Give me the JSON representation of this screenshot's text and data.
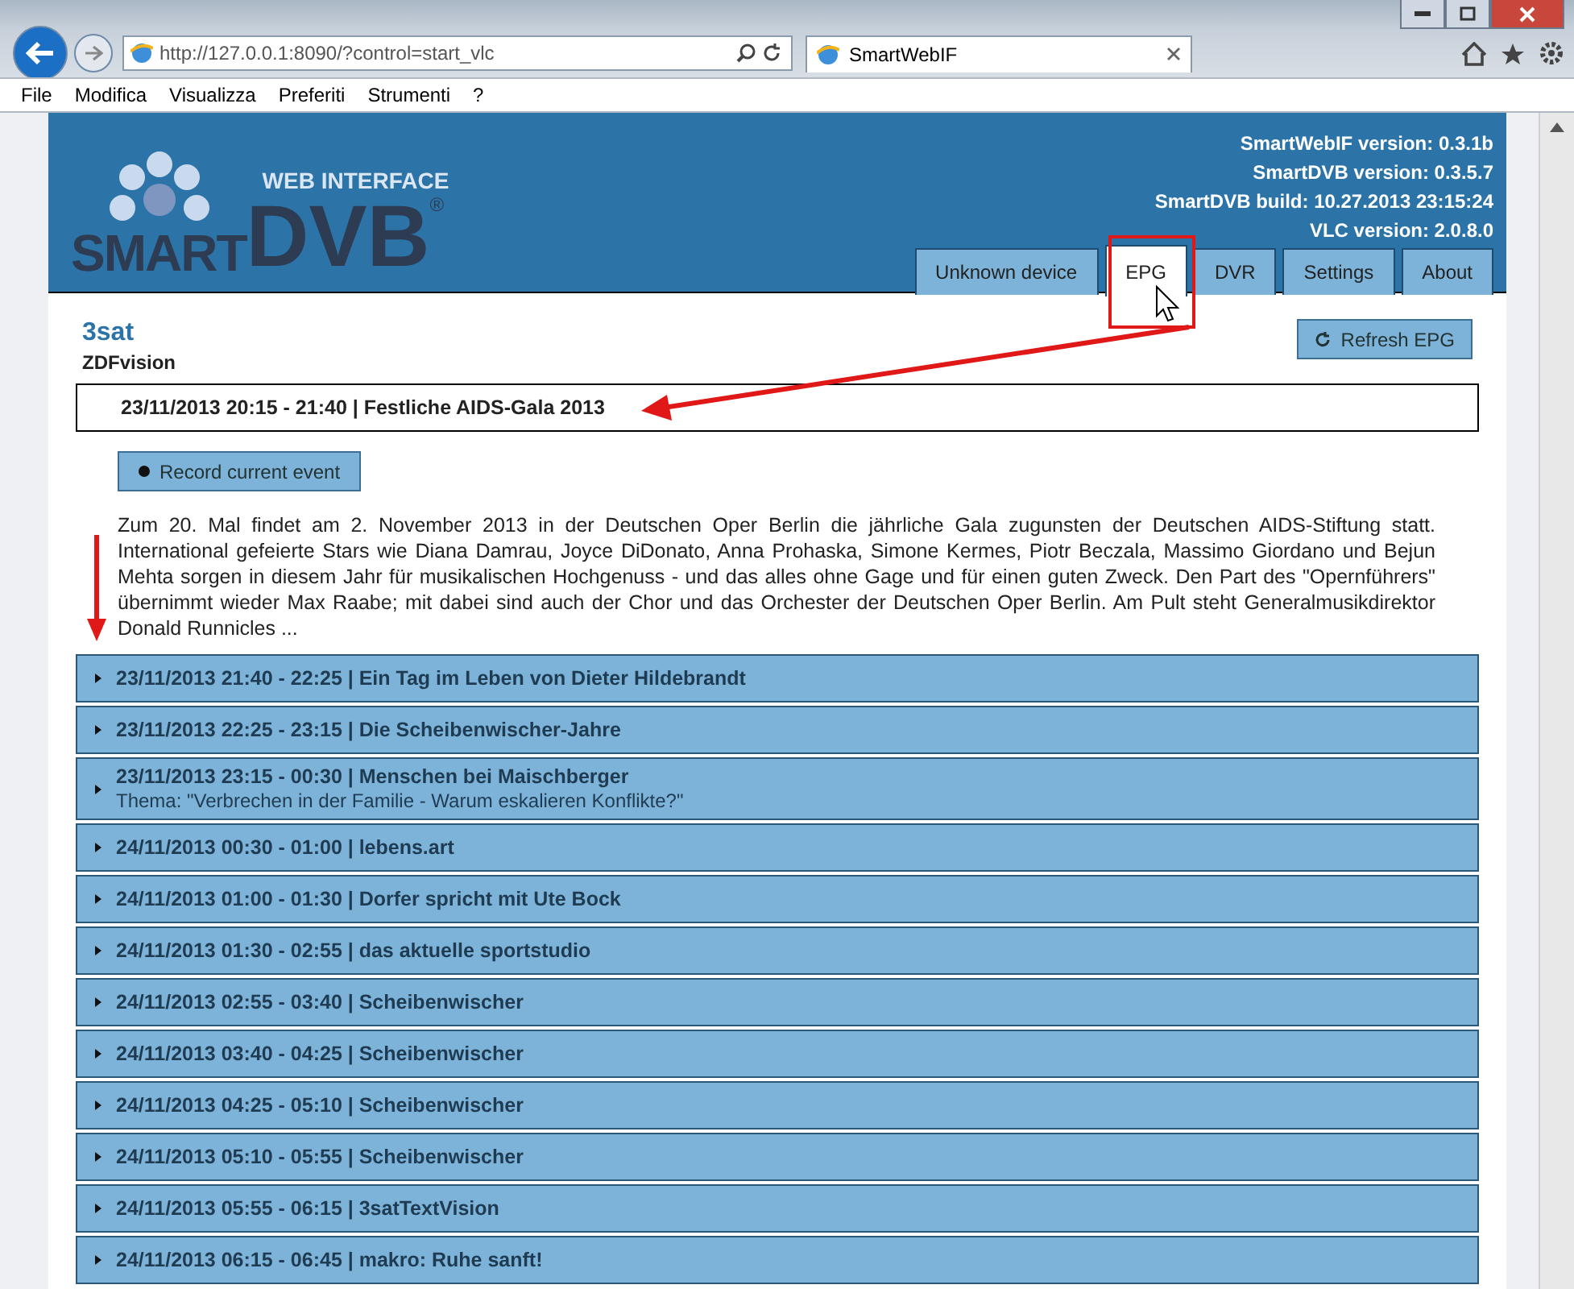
{
  "browser": {
    "address": "http://127.0.0.1:8090/?control=start_vlc",
    "tab": {
      "title": "SmartWebIF",
      "selected": true
    },
    "menu": [
      "File",
      "Modifica",
      "Visualizza",
      "Preferiti",
      "Strumenti",
      "?"
    ]
  },
  "header": {
    "logo": {
      "tagline": "WEB INTERFACE",
      "word": "SMART",
      "brand": "DVB",
      "mark": "®"
    },
    "versions": [
      "SmartWebIF version: 0.3.1b",
      "SmartDVB version: 0.3.5.7",
      "SmartDVB build: 10.27.2013 23:15:24",
      "VLC version: 2.0.8.0"
    ],
    "tabs": [
      {
        "label": "Unknown device",
        "selected": false
      },
      {
        "label": "EPG",
        "selected": true
      },
      {
        "label": "DVR",
        "selected": false
      },
      {
        "label": "Settings",
        "selected": false
      },
      {
        "label": "About",
        "selected": false
      }
    ]
  },
  "channel": {
    "name": "3sat",
    "provider": "ZDFvision",
    "refresh_button": "Refresh EPG"
  },
  "current_event": {
    "title": "23/11/2013 20:15 - 21:40 | Festliche AIDS-Gala 2013",
    "record_button": "Record current event",
    "description": "Zum 20. Mal findet am 2. November 2013 in der Deutschen Oper Berlin die jährliche Gala zugunsten der Deutschen AIDS-Stiftung statt. International gefeierte Stars wie Diana Damrau, Joyce DiDonato, Anna Prohaska, Simone Kermes, Piotr Beczala, Massimo Giordano und Bejun Mehta sorgen in diesem Jahr für musikalischen Hochgenuss - und das alles ohne Gage und für einen guten Zweck. Den Part des \"Opernführers\" übernimmt wieder Max Raabe; mit dabei sind auch der Chor und das Orchester der Deutschen Oper Berlin. Am Pult steht Generalmusikdirektor Donald Runnicles ..."
  },
  "events": [
    {
      "title": "23/11/2013 21:40 - 22:25 | Ein Tag im Leben von Dieter Hildebrandt",
      "expanded": false
    },
    {
      "title": "23/11/2013 22:25 - 23:15 | Die Scheibenwischer-Jahre",
      "expanded": false
    },
    {
      "title": "23/11/2013 23:15 - 00:30 | Menschen bei Maischberger",
      "subtitle": "Thema: \"Verbrechen in der Familie - Warum eskalieren Konflikte?\"",
      "expanded": false
    },
    {
      "title": "24/11/2013 00:30 - 01:00 | lebens.art",
      "expanded": false
    },
    {
      "title": "24/11/2013 01:00 - 01:30 | Dorfer spricht mit Ute Bock",
      "expanded": false
    },
    {
      "title": "24/11/2013 01:30 - 02:55 | das aktuelle sportstudio",
      "expanded": false
    },
    {
      "title": "24/11/2013 02:55 - 03:40 | Scheibenwischer",
      "expanded": false
    },
    {
      "title": "24/11/2013 03:40 - 04:25 | Scheibenwischer",
      "expanded": false
    },
    {
      "title": "24/11/2013 04:25 - 05:10 | Scheibenwischer",
      "expanded": false
    },
    {
      "title": "24/11/2013 05:10 - 05:55 | Scheibenwischer",
      "expanded": false
    },
    {
      "title": "24/11/2013 05:55 - 06:15 | 3satTextVision",
      "expanded": false
    },
    {
      "title": "24/11/2013 06:15 - 06:45 | makro: Ruhe sanft!",
      "expanded": false
    }
  ]
}
